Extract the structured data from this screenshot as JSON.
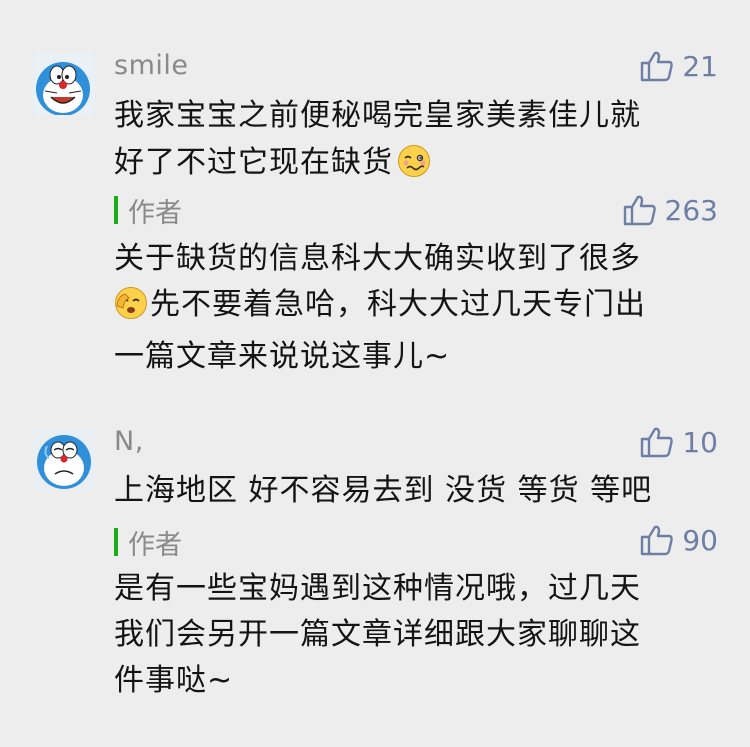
{
  "comments": [
    {
      "user": "smile",
      "likes": "21",
      "text_lines": [
        "我家宝宝之前便秘喝完皇家美素佳儿就",
        "好了不过它现在缺货"
      ],
      "emoji": "woozy-face-emoji",
      "reply": {
        "author_label": "作者",
        "likes": "263",
        "text_lines": [
          "关于缺货的信息科大大确实收到了很多",
          "先不要着急哈，科大大过几天专门出",
          "一篇文章来说说这事儿~"
        ],
        "emoji": "face-palm-emoji"
      }
    },
    {
      "user": "N,",
      "likes": "10",
      "text_lines": [
        "上海地区 好不容易去到 没货 等货 等吧"
      ],
      "reply": {
        "author_label": "作者",
        "likes": "90",
        "text_lines": [
          "是有一些宝妈遇到这种情况哦，过几天",
          "我们会另开一篇文章详细跟大家聊聊这",
          "件事哒~"
        ]
      }
    }
  ],
  "colors": {
    "background": "#ededed",
    "author_bar": "#1aad19",
    "like_icon": "#6e7fa6",
    "meta_text": "#8a8a8a"
  },
  "icons": {
    "like": "thumbs-up-icon"
  }
}
